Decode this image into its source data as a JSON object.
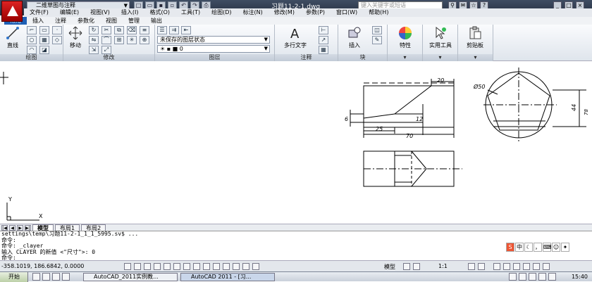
{
  "titlebar": {
    "workspace": "二维草图与注释",
    "doc_title": "习题11-2-1.dwg",
    "search_placeholder": "键入关键字或短语"
  },
  "menu": [
    "文件(F)",
    "编辑(E)",
    "视图(V)",
    "插入(I)",
    "格式(O)",
    "工具(T)",
    "绘图(D)",
    "标注(N)",
    "修改(M)",
    "参数(P)",
    "窗口(W)",
    "帮助(H)"
  ],
  "tabs": [
    "常用",
    "插入",
    "注释",
    "参数化",
    "视图",
    "管理",
    "输出"
  ],
  "ribbon": {
    "line_label": "直线",
    "move_label": "移动",
    "layer_state": "未保存的图层状态",
    "mtext_label": "多行文字",
    "insert_label": "插入",
    "properties_label": "特性",
    "utilities_label": "实用工具",
    "clipboard_label": "剪贴板",
    "panel_draw": "绘图",
    "panel_modify": "修改",
    "panel_layer": "图层",
    "panel_annotation": "注释",
    "panel_block": "块",
    "layer_value": "0"
  },
  "drawing": {
    "dim_20": "20",
    "dim_6": "6",
    "dim_12": "12",
    "dim_25": "25",
    "dim_70": "70",
    "dim_phi50": "Ø50",
    "dim_44": "44",
    "dim_78": "78",
    "ucs_y": "Y",
    "ucs_x": "X"
  },
  "layout_tabs": [
    "模型",
    "布局1",
    "布局2"
  ],
  "command_lines": [
    "settings\\temp\\习题11-2-1_1_1_5995.sv$ ...",
    "命令:",
    "命令: _clayer",
    "输入 CLAYER 的新值 <\"尺寸\">: 0",
    "命令:"
  ],
  "status": {
    "coords": "-358.1019, 186.6842, 0.0000",
    "model_label": "模型",
    "scale": "1:1",
    "ime_label": "中"
  },
  "taskbar": {
    "start_label": "开始",
    "task1": "AutoCAD_2011实例教...",
    "task2": "AutoCAD 2011 - [习...",
    "clock": "15:40"
  },
  "colors": {
    "title_bg": "#2f3a4c",
    "tab_active": "#1e5fb4",
    "logo_red": "#cc2222"
  }
}
